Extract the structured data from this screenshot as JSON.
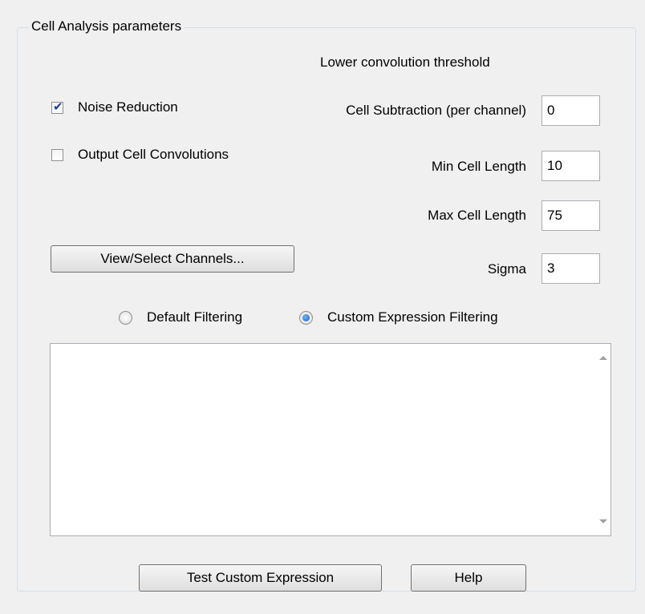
{
  "group": {
    "title": "Cell Analysis parameters"
  },
  "threshold_label": "Lower convolution threshold",
  "checkboxes": {
    "noise_reduction": {
      "label": "Noise Reduction",
      "checked": true
    },
    "output_cell_convolutions": {
      "label": "Output Cell Convolutions",
      "checked": false
    }
  },
  "fields": {
    "cell_subtraction": {
      "label": "Cell Subtraction (per channel)",
      "value": "0"
    },
    "min_cell_length": {
      "label": "Min Cell Length",
      "value": "10"
    },
    "max_cell_length": {
      "label": "Max Cell Length",
      "value": "75"
    },
    "sigma": {
      "label": "Sigma",
      "value": "3"
    }
  },
  "buttons": {
    "view_select_channels": "View/Select Channels...",
    "test_custom_expression": "Test Custom Expression",
    "help": "Help"
  },
  "filtering": {
    "default_label": "Default Filtering",
    "custom_label": "Custom Expression Filtering",
    "selected": "custom"
  },
  "expression_text": "",
  "colors": {
    "background": "#f0f0f0",
    "check_mark": "#1f3f8c",
    "radio_selected": "#1a5fb4"
  }
}
